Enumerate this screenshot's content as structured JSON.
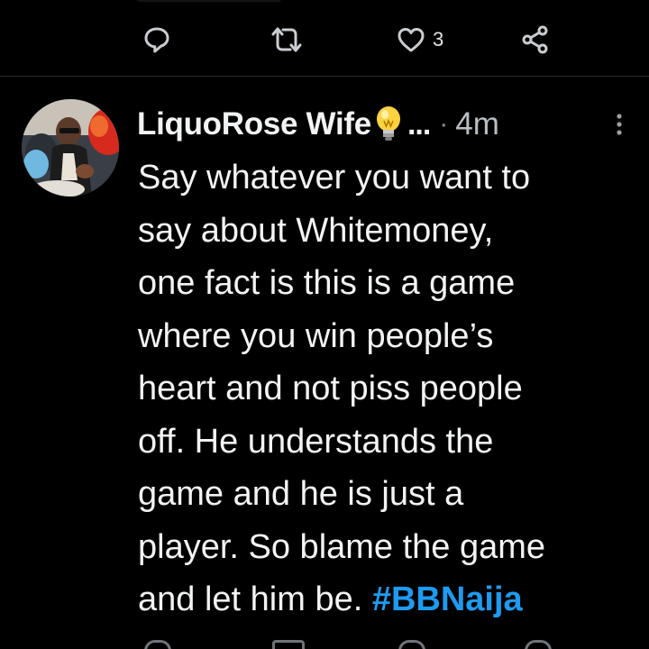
{
  "previous_tweet": {
    "actions": {
      "reply_icon": "reply-icon",
      "retweet_icon": "retweet-icon",
      "like_icon": "heart-icon",
      "like_count": "3",
      "share_icon": "share-icon"
    }
  },
  "tweet": {
    "display_name": "LiquoRose Wife",
    "name_emoji": "light-bulb-icon",
    "truncation": "...",
    "separator": "·",
    "timestamp": "4m",
    "body_lines": [
      "Say whatever you want to",
      "say about Whitemoney,",
      "one fact is this is a game",
      "where you win people’s",
      "heart and not piss people",
      "off.  He understands the",
      "game and he is just a",
      "player. So blame the game"
    ],
    "last_line_text": "and let him be. ",
    "hashtag": "#BBNaija"
  },
  "colors": {
    "background": "#000000",
    "text": "#f2f3f4",
    "muted": "#b9bec3",
    "hashtag": "#1d9bf0",
    "divider": "#2a2d31"
  }
}
